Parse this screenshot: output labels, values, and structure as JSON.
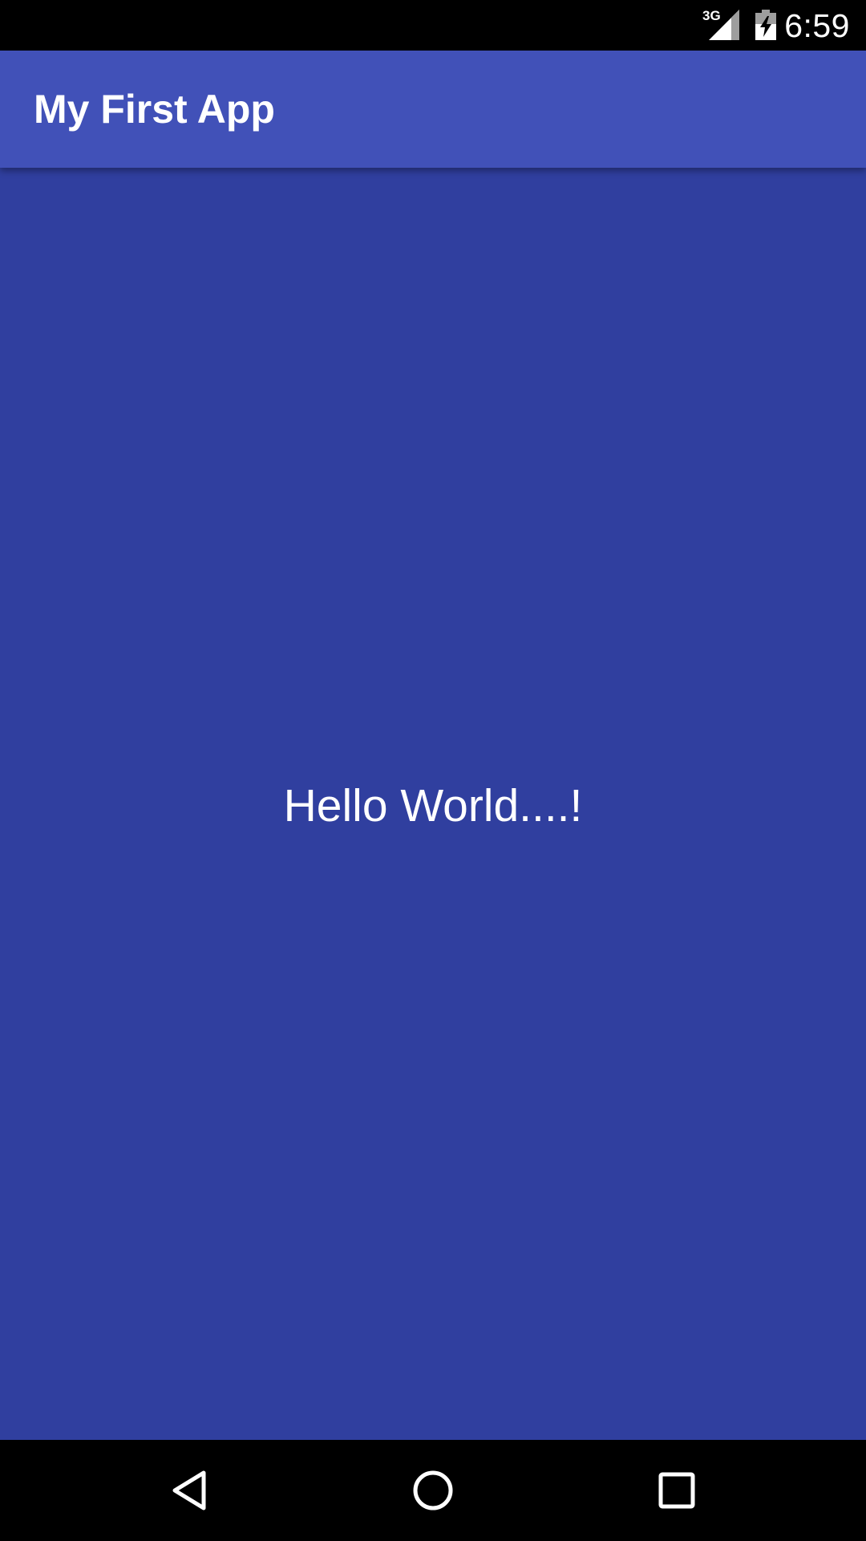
{
  "status_bar": {
    "network_label": "3G",
    "time": "6:59",
    "icons": [
      "signal-icon",
      "battery-charging-icon"
    ]
  },
  "app_bar": {
    "title": "My First App"
  },
  "main": {
    "text": "Hello World....!"
  },
  "nav_bar": {
    "icons": [
      "back-icon",
      "home-icon",
      "recents-icon"
    ]
  },
  "colors": {
    "app_bar": "#4151b8",
    "background": "#303f9f",
    "system_bars": "#000000",
    "text": "#ffffff"
  }
}
